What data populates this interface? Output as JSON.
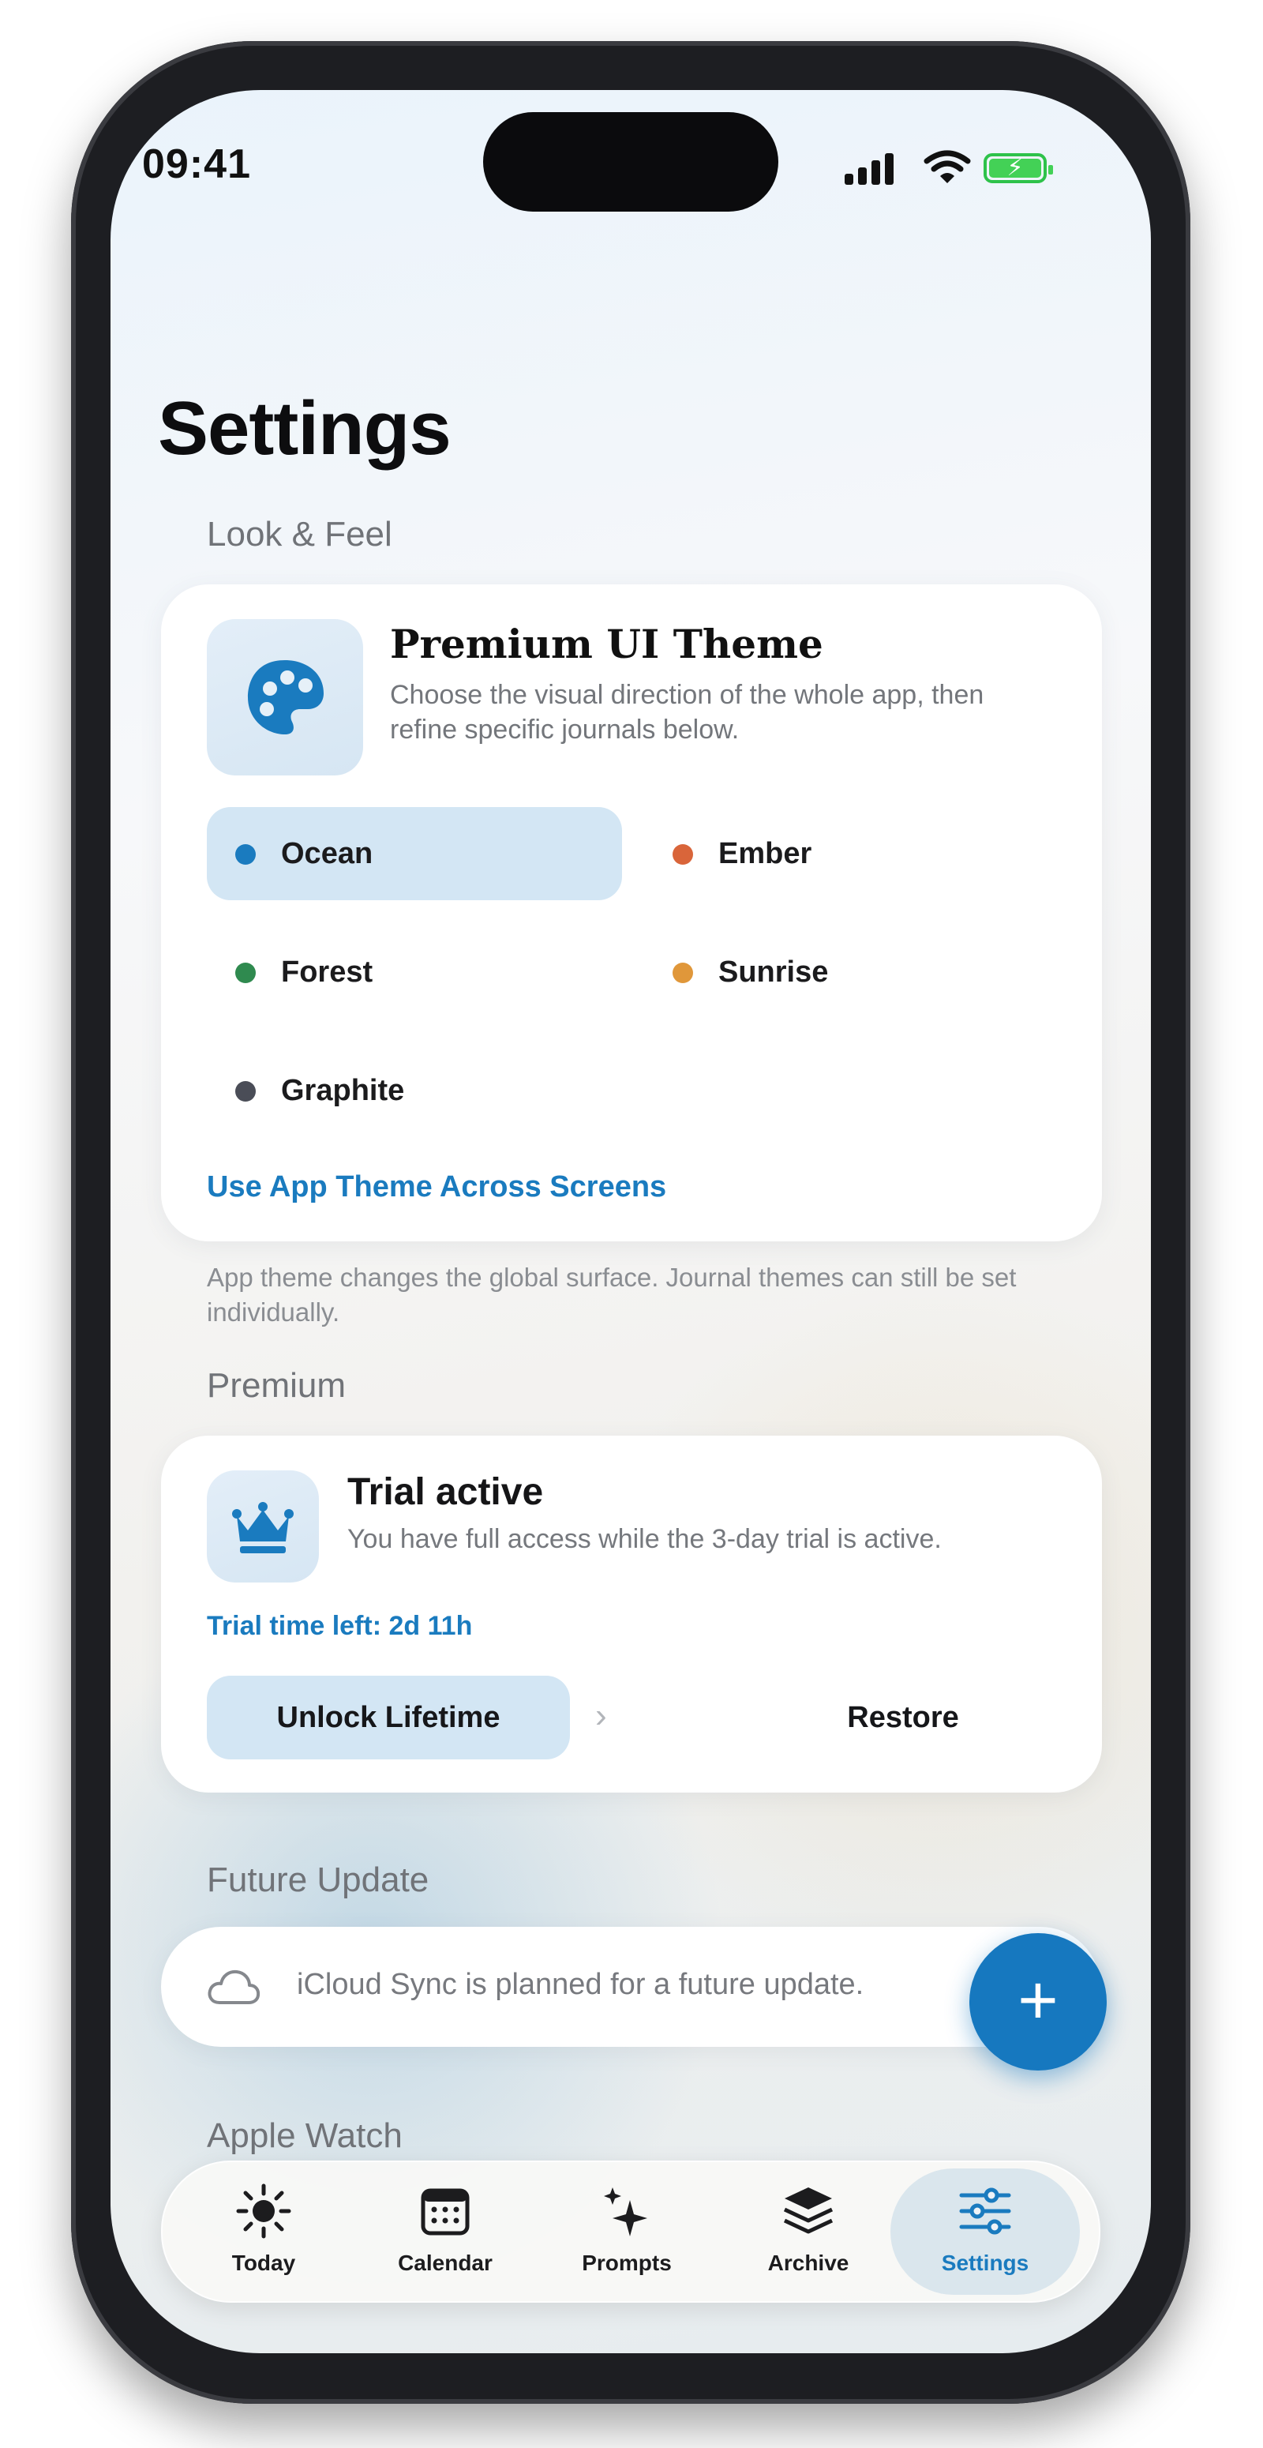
{
  "status_bar": {
    "time": "09:41"
  },
  "page": {
    "title": "Settings"
  },
  "look_feel": {
    "header": "Look & Feel",
    "card_title": "Premium UI Theme",
    "card_description": "Choose the visual direction of the whole app, then refine specific journals below.",
    "themes": [
      {
        "label": "Ocean",
        "color": "#1a7bbf",
        "selected": true
      },
      {
        "label": "Ember",
        "color": "#d9653a",
        "selected": false
      },
      {
        "label": "Forest",
        "color": "#2f8a4f",
        "selected": false
      },
      {
        "label": "Sunrise",
        "color": "#e0973a",
        "selected": false
      },
      {
        "label": "Graphite",
        "color": "#4a4d57",
        "selected": false
      }
    ],
    "link": "Use App Theme Across Screens",
    "footnote": "App theme changes the global surface. Journal themes can still be set individually."
  },
  "premium": {
    "header": "Premium",
    "title": "Trial active",
    "description": "You have full access while the 3-day trial is active.",
    "time_left": "Trial time left: 2d 11h",
    "unlock_button": "Unlock Lifetime",
    "restore_button": "Restore"
  },
  "future_update": {
    "header": "Future Update",
    "message": "iCloud Sync is planned for a future update."
  },
  "apple_watch": {
    "header": "Apple Watch"
  },
  "fab": {
    "label": "+"
  },
  "tab_bar": {
    "tabs": [
      {
        "label": "Today",
        "icon": "sun-icon",
        "active": false
      },
      {
        "label": "Calendar",
        "icon": "calendar-icon",
        "active": false
      },
      {
        "label": "Prompts",
        "icon": "sparkles-icon",
        "active": false
      },
      {
        "label": "Archive",
        "icon": "stack-icon",
        "active": false
      },
      {
        "label": "Settings",
        "icon": "sliders-icon",
        "active": true
      }
    ]
  },
  "colors": {
    "accent": "#1a7bbf",
    "selection": "#d3e6f4"
  }
}
